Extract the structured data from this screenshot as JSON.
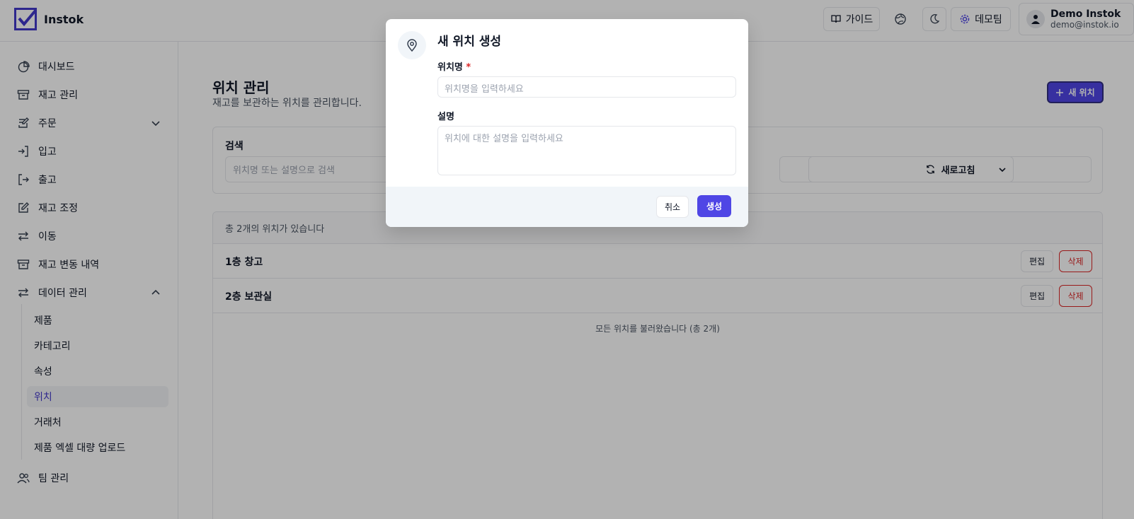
{
  "app": {
    "name": "Instok"
  },
  "header": {
    "guide_label": "가이드",
    "team_label": "데모팀",
    "user_name": "Demo Instok",
    "user_email": "demo@instok.io"
  },
  "sidebar": {
    "items": [
      {
        "label": "대시보드",
        "icon": "pie-chart-icon"
      },
      {
        "label": "재고 관리",
        "icon": "archive-icon"
      },
      {
        "label": "주문",
        "icon": "edit-note-icon"
      },
      {
        "label": "입고",
        "icon": "login-icon"
      },
      {
        "label": "출고",
        "icon": "logout-icon"
      },
      {
        "label": "재고 조정",
        "icon": "pencil-square-icon"
      },
      {
        "label": "이동",
        "icon": "arrows-icon"
      },
      {
        "label": "재고 변동 내역",
        "icon": "archive-icon"
      },
      {
        "label": "데이터 관리",
        "icon": "arrows-icon"
      },
      {
        "label": "팀 관리",
        "icon": "users-icon"
      }
    ],
    "subitems": [
      {
        "label": "제품"
      },
      {
        "label": "카테고리"
      },
      {
        "label": "속성"
      },
      {
        "label": "위치"
      },
      {
        "label": "거래처"
      },
      {
        "label": "제품 엑셀 대량 업로드"
      }
    ]
  },
  "main": {
    "title": "위치 관리",
    "subtitle": "재고를 보관하는 위치를 관리합니다.",
    "new_button": "새 위치",
    "search_label": "검색",
    "search_placeholder": "위치명 또는 설명으로 검색",
    "refresh_label": "새로고침",
    "list_count": "총 2개의 위치가 있습니다",
    "rows": [
      {
        "name": "1층 창고",
        "edit": "편집",
        "delete": "삭제"
      },
      {
        "name": "2층 보관실",
        "edit": "편집",
        "delete": "삭제"
      }
    ],
    "footer": "모든 위치를 불러왔습니다 (총 2개)"
  },
  "modal": {
    "title": "새 위치 생성",
    "name_label": "위치명",
    "required_mark": "*",
    "name_placeholder": "위치명을 입력하세요",
    "desc_label": "설명",
    "desc_placeholder": "위치에 대한 설명을 입력하세요",
    "cancel_label": "취소",
    "create_label": "생성"
  },
  "colors": {
    "accent": "#4f46e5",
    "danger": "#dc2626"
  }
}
